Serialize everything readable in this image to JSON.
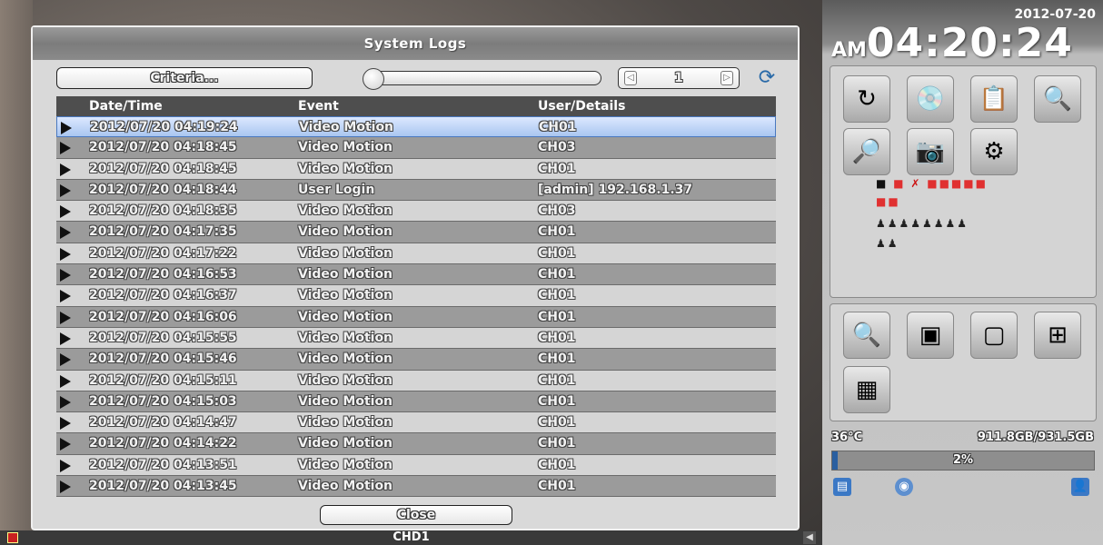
{
  "dialog": {
    "title": "System Logs",
    "criteria_label": "Criteria...",
    "page_number": "1",
    "close_label": "Close",
    "columns": [
      "Date/Time",
      "Event",
      "User/Details"
    ],
    "rows": [
      {
        "time": "2012/07/20 04:19:24",
        "event": "Video Motion",
        "details": "CH01"
      },
      {
        "time": "2012/07/20 04:18:45",
        "event": "Video Motion",
        "details": "CH03"
      },
      {
        "time": "2012/07/20 04:18:45",
        "event": "Video Motion",
        "details": "CH01"
      },
      {
        "time": "2012/07/20 04:18:44",
        "event": "User Login",
        "details": "[admin] 192.168.1.37"
      },
      {
        "time": "2012/07/20 04:18:35",
        "event": "Video Motion",
        "details": "CH03"
      },
      {
        "time": "2012/07/20 04:17:35",
        "event": "Video Motion",
        "details": "CH01"
      },
      {
        "time": "2012/07/20 04:17:22",
        "event": "Video Motion",
        "details": "CH01"
      },
      {
        "time": "2012/07/20 04:16:53",
        "event": "Video Motion",
        "details": "CH01"
      },
      {
        "time": "2012/07/20 04:16:37",
        "event": "Video Motion",
        "details": "CH01"
      },
      {
        "time": "2012/07/20 04:16:06",
        "event": "Video Motion",
        "details": "CH01"
      },
      {
        "time": "2012/07/20 04:15:55",
        "event": "Video Motion",
        "details": "CH01"
      },
      {
        "time": "2012/07/20 04:15:46",
        "event": "Video Motion",
        "details": "CH01"
      },
      {
        "time": "2012/07/20 04:15:11",
        "event": "Video Motion",
        "details": "CH01"
      },
      {
        "time": "2012/07/20 04:15:03",
        "event": "Video Motion",
        "details": "CH01"
      },
      {
        "time": "2012/07/20 04:14:47",
        "event": "Video Motion",
        "details": "CH01"
      },
      {
        "time": "2012/07/20 04:14:22",
        "event": "Video Motion",
        "details": "CH01"
      },
      {
        "time": "2012/07/20 04:13:51",
        "event": "Video Motion",
        "details": "CH01"
      },
      {
        "time": "2012/07/20 04:13:45",
        "event": "Video Motion",
        "details": "CH01"
      }
    ],
    "selected_row": 0
  },
  "bottom": {
    "channel_label": "CHD1"
  },
  "sidebar": {
    "date": "2012-07-20",
    "ampm": "AM",
    "time": "04:20:24",
    "temperature": "36°C",
    "disk_usage": "911.8GB/931.5GB",
    "usage_percent_text": "2%",
    "usage_fraction": 0.02
  },
  "icons": {
    "panel1": [
      "playback-icon",
      "backup-icon",
      "log-icon",
      "search-log-icon",
      "camera-search-icon",
      "webcam-icon",
      "settings-gear-icon"
    ],
    "panel2": [
      "zoom-icon",
      "pip-layout-icon",
      "single-layout-icon",
      "quad-layout-icon",
      "nine-grid-layout-icon"
    ]
  },
  "colors": {
    "accent_blue": "#2a5fa0",
    "alarm_red": "#e03030",
    "selected_row": "#a9c6f0"
  }
}
